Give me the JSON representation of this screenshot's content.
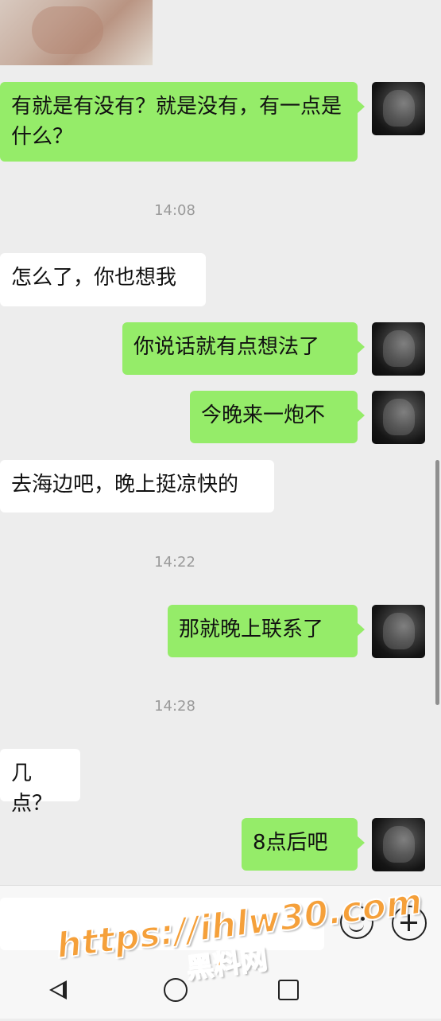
{
  "messages": [
    {
      "from": "me",
      "text": "有就是有没有？就是没有，有一点是什么？"
    },
    {
      "from": "time",
      "text": "14:08"
    },
    {
      "from": "them",
      "text": "怎么了，你也想我"
    },
    {
      "from": "me",
      "text": "你说话就有点想法了"
    },
    {
      "from": "me",
      "text": "今晚来一炮不"
    },
    {
      "from": "them",
      "text": "去海边吧，晚上挺凉快的"
    },
    {
      "from": "time",
      "text": "14:22"
    },
    {
      "from": "me",
      "text": "那就晚上联系了"
    },
    {
      "from": "time",
      "text": "14:28"
    },
    {
      "from": "them",
      "text": "几点？"
    },
    {
      "from": "me",
      "text": "8点后吧"
    }
  ],
  "input_bar": {
    "value": "",
    "emoji_icon": "emoji-icon",
    "plus_icon": "plus-icon"
  },
  "nav_bar": {
    "back_icon": "back-triangle-icon",
    "home_icon": "home-circle-icon",
    "recent_icon": "recent-square-icon"
  },
  "watermark": {
    "url": "https://ihlw30.com",
    "name": "黑料网"
  },
  "colors": {
    "me_bubble": "#95ec69",
    "them_bubble": "#ffffff",
    "background": "#ededed",
    "watermark": "#f5a03a"
  }
}
